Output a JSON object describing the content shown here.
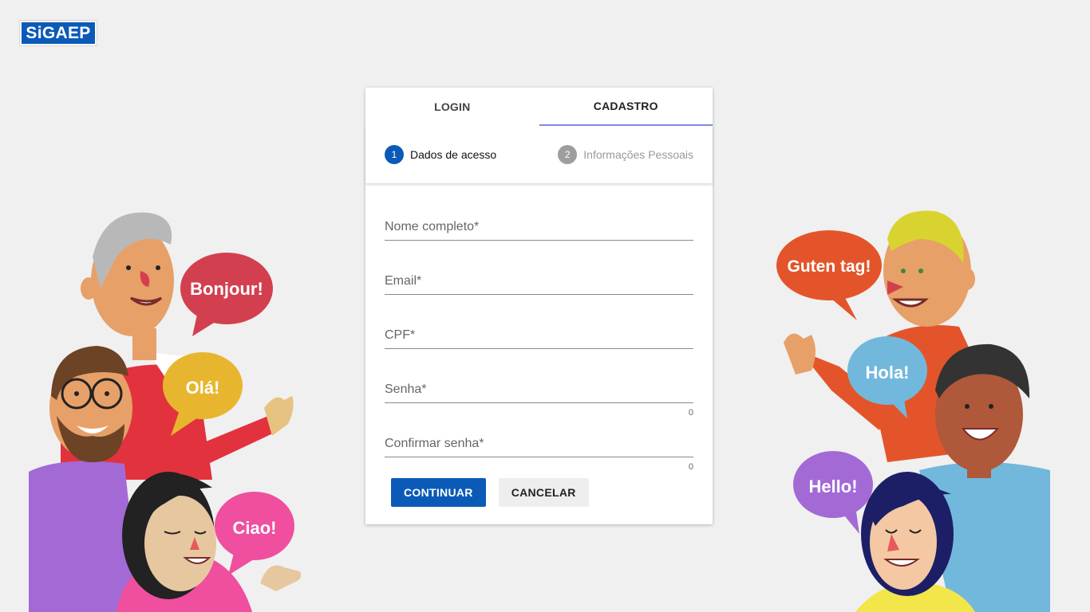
{
  "logo": {
    "text": "SiGAEP"
  },
  "tabs": [
    {
      "label": "LOGIN",
      "active": false
    },
    {
      "label": "CADASTRO",
      "active": true
    }
  ],
  "stepper": {
    "steps": [
      {
        "number": "1",
        "label": "Dados de acesso",
        "active": true
      },
      {
        "number": "2",
        "label": "Informações Pessoais",
        "active": false
      }
    ]
  },
  "form": {
    "fields": [
      {
        "label": "Nome completo*",
        "value": ""
      },
      {
        "label": "Email*",
        "value": ""
      },
      {
        "label": "CPF*",
        "value": ""
      },
      {
        "label": "Senha*",
        "value": "",
        "counter": "0"
      },
      {
        "label": "Confirmar senha*",
        "value": "",
        "counter": "0"
      }
    ]
  },
  "actions": {
    "continue_label": "CONTINUAR",
    "cancel_label": "CANCELAR"
  },
  "illustration_left": {
    "bubbles": [
      "Bonjour!",
      "Olá!",
      "Ciao!"
    ]
  },
  "illustration_right": {
    "bubbles": [
      "Guten tag!",
      "Hola!",
      "Hello!"
    ]
  },
  "colors": {
    "brand": "#0b5ab8",
    "tab_indicator": "#7d8ae6",
    "bubble_red": "#d2404f",
    "bubble_yellow": "#e8b62e",
    "bubble_pink": "#ef4f9e",
    "bubble_orange": "#e4542a",
    "bubble_blue": "#72b8dc",
    "bubble_purple": "#a36ad6"
  }
}
